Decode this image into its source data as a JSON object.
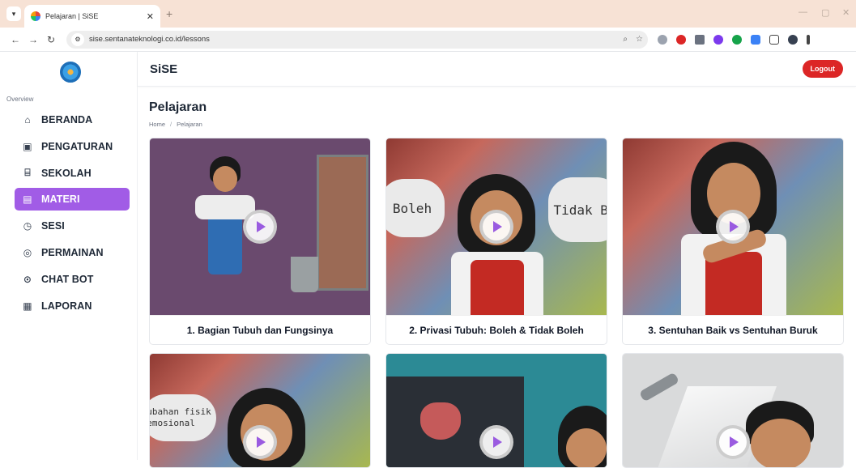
{
  "browser": {
    "tab_title": "Pelajaran | SiSE",
    "url": "sise.sentanateknologi.co.id/lessons"
  },
  "sidebar": {
    "section_label": "Overview",
    "items": [
      {
        "label": "BERANDA",
        "icon": "home-icon",
        "active": false
      },
      {
        "label": "PENGATURAN",
        "icon": "user-settings-icon",
        "active": false
      },
      {
        "label": "SEKOLAH",
        "icon": "school-icon",
        "active": false
      },
      {
        "label": "MATERI",
        "icon": "save-icon",
        "active": true
      },
      {
        "label": "SESI",
        "icon": "timer-icon",
        "active": false
      },
      {
        "label": "PERMAINAN",
        "icon": "gamepad-icon",
        "active": false
      },
      {
        "label": "CHAT BOT",
        "icon": "chat-bot-icon",
        "active": false
      },
      {
        "label": "LAPORAN",
        "icon": "report-icon",
        "active": false
      }
    ]
  },
  "header": {
    "brand": "SiSE",
    "logout_label": "Logout"
  },
  "page": {
    "title": "Pelajaran",
    "breadcrumb": [
      "Home",
      "Pelajaran"
    ]
  },
  "lessons": [
    {
      "title": "1. Bagian Tubuh dan Fungsinya"
    },
    {
      "title": "2. Privasi Tubuh: Boleh & Tidak Boleh",
      "bubbles": [
        "Boleh",
        "Tidak Bo"
      ]
    },
    {
      "title": "3. Sentuhan Baik vs Sentuhan Buruk"
    },
    {
      "title": "",
      "bubble": "ubahan fisik\nemosional"
    },
    {
      "title": ""
    },
    {
      "title": ""
    }
  ],
  "colors": {
    "accent": "#a15ce6",
    "logout": "#dc2626",
    "tabstrip": "#f7e2d5"
  }
}
